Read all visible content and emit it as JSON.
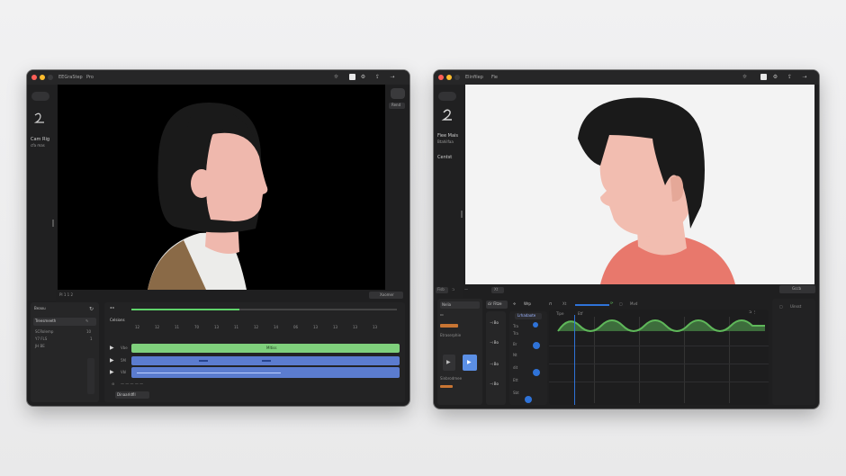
{
  "win1": {
    "title": "EEGraStep",
    "tab": "Pro",
    "sidebar": {
      "label1": "Cam Rig",
      "label2": "cfa mas"
    },
    "right_btn": "Rend",
    "viewer_footer_left": "PI  1  1  2",
    "viewer_footer_right": "Xoomer",
    "bottom_left": {
      "header": "Beaou",
      "section": "Treesmeeth",
      "rows": [
        "SCRolemp",
        "Y7 FLS",
        "JH BE"
      ],
      "row_vals": [
        "10 ",
        "1",
        "",
        ""
      ]
    },
    "timeline": {
      "label": "Celsions",
      "ruler": [
        "12",
        "12",
        "11",
        "70",
        "13",
        "11",
        "12",
        "14",
        "06",
        "13",
        "13",
        "13",
        "13"
      ],
      "track_names": [
        "Vbe",
        "5M",
        "Vbl"
      ],
      "track1_label": "Mltiss",
      "bottom_label": "Dinaarldfll"
    }
  },
  "win2": {
    "title": "Elinfilep",
    "tab": "Fie",
    "sidebar": {
      "label1": "Fiee Mais",
      "label2": "Btahilfaa",
      "label3": "Centst"
    },
    "viewer_footer": [
      "Fisb",
      "Xt"
    ],
    "toolbar_right": "Gccb",
    "side_buttons": [
      "Nelia",
      "Etraserphie",
      "Sinbrodmee"
    ],
    "col": {
      "header": "cir Fitze",
      "labels": [
        "Tra",
        "Tra",
        "Br",
        "Nt",
        "dit",
        "Ett",
        "Sbt"
      ]
    },
    "timeline_header": "Lrhadaote",
    "timeline_top": [
      "Tipe",
      "Etf"
    ],
    "wave_color": "#5fb85a",
    "right_panel": "Uinsst"
  }
}
